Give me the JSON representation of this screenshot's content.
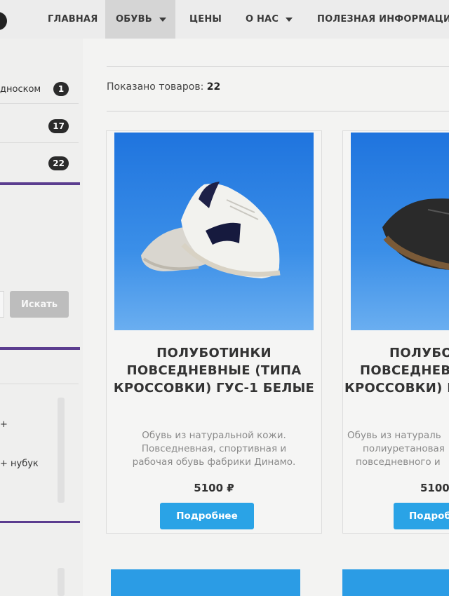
{
  "nav": {
    "items": [
      {
        "label": "ГЛАВНАЯ",
        "has_dropdown": false,
        "active": false
      },
      {
        "label": "ОБУВЬ",
        "has_dropdown": true,
        "active": true
      },
      {
        "label": "ЦЕНЫ",
        "has_dropdown": false,
        "active": false
      },
      {
        "label": "О НАС",
        "has_dropdown": true,
        "active": false
      },
      {
        "label": "ПОЛЕЗНАЯ ИНФОРМАЦИ",
        "has_dropdown": false,
        "active": false
      }
    ]
  },
  "sidebar": {
    "categories": [
      {
        "label": "дноском",
        "count": "1"
      },
      {
        "label": "",
        "count": "17"
      },
      {
        "label": "",
        "count": "22"
      }
    ],
    "search_button": "Искать",
    "filters": [
      {
        "label": "+"
      },
      {
        "label": "+ нубук"
      }
    ]
  },
  "main": {
    "shown_label": "Показано товаров:",
    "shown_count": "22",
    "products": [
      {
        "title_lines": [
          "ПОЛУБОТИНКИ",
          "ПОВСЕДНЕВНЫЕ (ТИПА",
          "КРОССОВКИ) ГУС-1 БЕЛЫЕ"
        ],
        "desc_lines": [
          "Обувь из натуральной кожи.",
          "Повседневная, спортивная и",
          "рабочая обувь фабрики Динамо."
        ],
        "price": "5100 ₽",
        "button": "Подробнее",
        "image_icon": "white-sneaker-image"
      },
      {
        "title_lines": [
          "ПОЛУБО",
          "ПОВСЕДНЕВ",
          "КРОССОВКИ) Г"
        ],
        "desc_lines": [
          "Обувь из натураль",
          "полиуретановая",
          "повседневного и"
        ],
        "price": "5100",
        "button": "Подроб",
        "image_icon": "black-sneaker-image"
      }
    ]
  },
  "colors": {
    "accent_button": "#2aa3e6",
    "sidebar_divider": "#5b3d8f",
    "badge": "#2b2b2b",
    "image_background": "#1f74de"
  }
}
